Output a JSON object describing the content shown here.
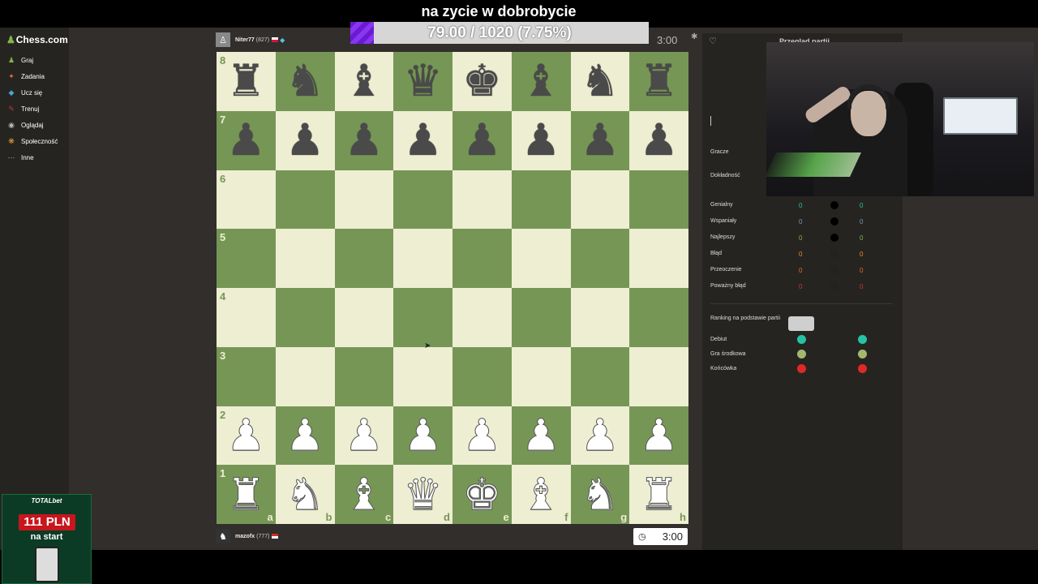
{
  "stream": {
    "title": "na zycie w dobrobycie",
    "goal_text": "79.00 / 1020 (7.75%)",
    "goal_fraction": 0.0775,
    "accent": "#7b2cf0"
  },
  "sidebar": {
    "logo": "Chess.com",
    "items": [
      {
        "label": "Graj",
        "icon": "play-icon",
        "color": "#81b64c"
      },
      {
        "label": "Zadania",
        "icon": "puzzle-icon",
        "color": "#e06b2b"
      },
      {
        "label": "Ucz się",
        "icon": "learn-icon",
        "color": "#3fa9d6"
      },
      {
        "label": "Trenuj",
        "icon": "train-icon",
        "color": "#c13c3c"
      },
      {
        "label": "Oglądaj",
        "icon": "watch-icon",
        "color": "#bbbbbb"
      },
      {
        "label": "Społeczność",
        "icon": "community-icon",
        "color": "#e0a13a"
      },
      {
        "label": "Inne",
        "icon": "more-icon",
        "color": "#bbbbbb"
      }
    ]
  },
  "players": {
    "top": {
      "name": "Niter77",
      "rating": "(827)"
    },
    "bottom": {
      "name": "mazofx",
      "rating": "(777)"
    }
  },
  "clocks": {
    "top": "3:00",
    "bottom": "3:00"
  },
  "board": {
    "ranks": [
      "8",
      "7",
      "6",
      "5",
      "4",
      "3",
      "2",
      "1"
    ],
    "files": [
      "a",
      "b",
      "c",
      "d",
      "e",
      "f",
      "g",
      "h"
    ],
    "position": [
      [
        "r",
        "n",
        "b",
        "q",
        "k",
        "b",
        "n",
        "r"
      ],
      [
        "p",
        "p",
        "p",
        "p",
        "p",
        "p",
        "p",
        "p"
      ],
      [
        "",
        "",
        "",
        "",
        "",
        "",
        "",
        ""
      ],
      [
        "",
        "",
        "",
        "",
        "",
        "",
        "",
        ""
      ],
      [
        "",
        "",
        "",
        "",
        "",
        "",
        "",
        ""
      ],
      [
        "",
        "",
        "",
        "",
        "",
        "",
        "",
        ""
      ],
      [
        "P",
        "P",
        "P",
        "P",
        "P",
        "P",
        "P",
        "P"
      ],
      [
        "R",
        "N",
        "B",
        "Q",
        "K",
        "B",
        "N",
        "R"
      ]
    ],
    "light_color": "#eeeed2",
    "dark_color": "#769656"
  },
  "review": {
    "panel_title": "Przegląd partii",
    "players_label": "Gracze",
    "accuracy_label": "Dokładność",
    "stats": [
      {
        "label": "Genialny",
        "w": "0",
        "b": "0",
        "color": "#26c2a3"
      },
      {
        "label": "Wspaniały",
        "w": "0",
        "b": "0",
        "color": "#749bbf"
      },
      {
        "label": "Najlepszy",
        "w": "0",
        "b": "0",
        "color": "#81b64c"
      },
      {
        "label": "Błąd",
        "w": "0",
        "b": "0",
        "color": "#e58f2a"
      },
      {
        "label": "Przeoczenie",
        "w": "0",
        "b": "0",
        "color": "#e6692a"
      },
      {
        "label": "Poważny błąd",
        "w": "0",
        "b": "0",
        "color": "#ca3431"
      }
    ],
    "ranking_label": "Ranking na podstawie partii",
    "phases": [
      {
        "label": "Debiut",
        "w_color": "#26c2a3",
        "b_color": "#26c2a3"
      },
      {
        "label": "Gra środkowa",
        "w_color": "#a3b86c",
        "b_color": "#a3b86c"
      },
      {
        "label": "Końcówka",
        "w_color": "#e02828",
        "b_color": "#e02828"
      }
    ]
  },
  "ad": {
    "brand": "TOTALbet",
    "amount": "111 PLN",
    "subtitle": "na start"
  }
}
